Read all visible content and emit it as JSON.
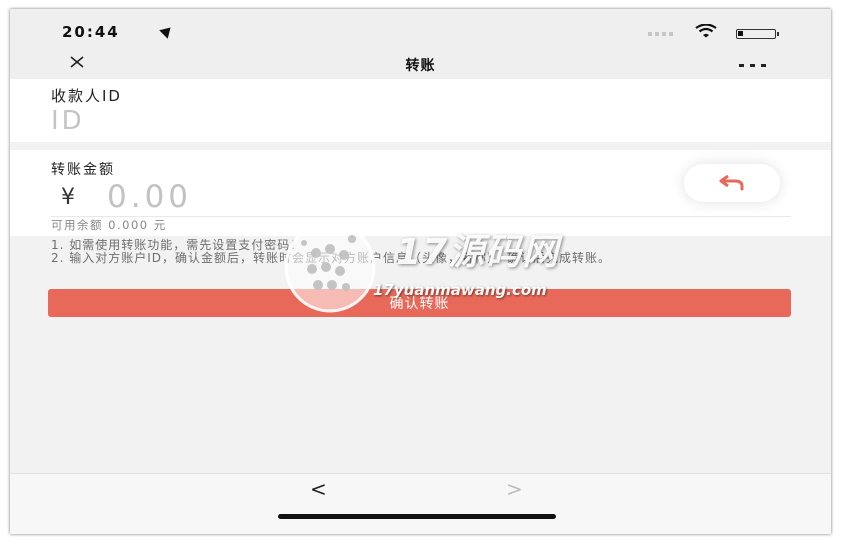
{
  "status_bar": {
    "time": "20:44"
  },
  "nav": {
    "title": "转账"
  },
  "recipient": {
    "label": "收款人ID",
    "placeholder": "ID"
  },
  "amount": {
    "label": "转账金额",
    "currency_symbol": "¥",
    "placeholder": "0.00",
    "balance_text": "可用余额 0.000 元"
  },
  "instructions": {
    "line1": "1. 如需使用转账功能，需先设置支付密码！",
    "line2": "2. 输入对方账户ID，确认金额后，转账时会显示对方账户信息（头像，名称），确认后完成转账。"
  },
  "confirm_button": {
    "label": "确认转账"
  },
  "watermark": {
    "text": "17源码网",
    "url": "17yuanmawang.com"
  },
  "browser_toolbar": {
    "back_glyph": "<",
    "forward_glyph": ">"
  },
  "colors": {
    "accent": "#e8695a",
    "background": "#f2f2f2"
  },
  "icons": [
    "location-icon",
    "wifi-icon",
    "battery-icon",
    "close-icon",
    "more-icon",
    "undo-icon"
  ]
}
